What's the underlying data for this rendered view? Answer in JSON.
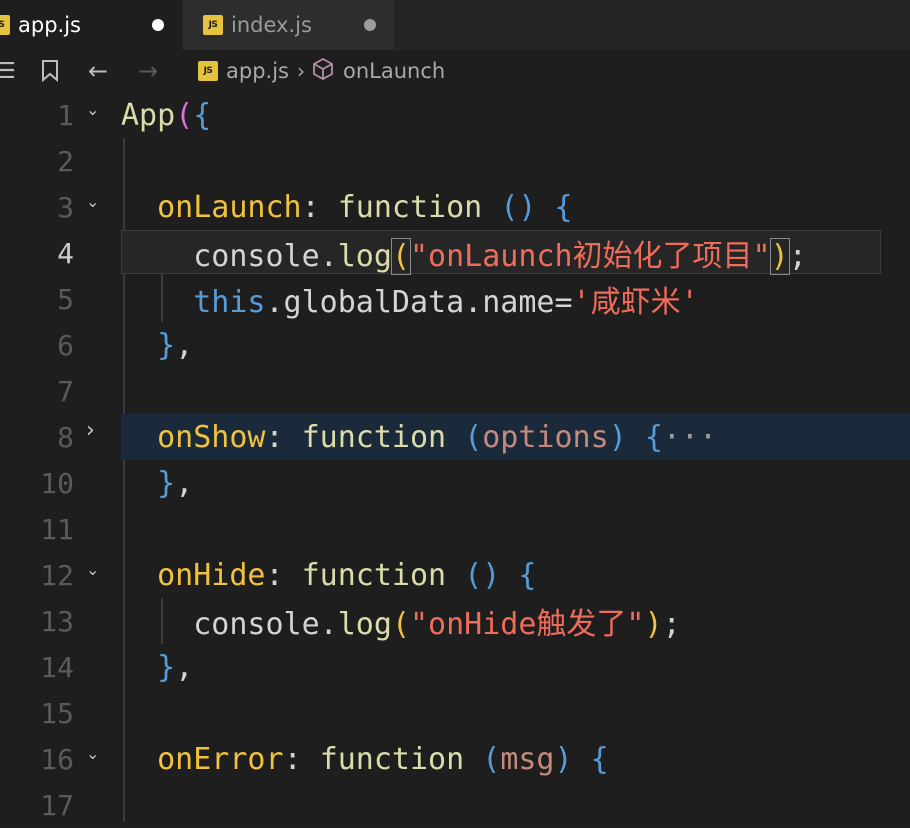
{
  "tabs": [
    {
      "label": "app.js",
      "icon": "js-file-icon",
      "active": true
    },
    {
      "label": "index.js",
      "icon": "js-file-icon",
      "active": false
    }
  ],
  "breadcrumb": {
    "file": "app.js",
    "symbol": "onLaunch"
  },
  "icons": {
    "js_badge": "JS",
    "menu": "☰",
    "back": "←",
    "forward": "→",
    "chevron_down": "⌄",
    "chevron_right": "›",
    "crumb_sep": "›",
    "cube": "⬡"
  },
  "colors": {
    "editor_bg": "#1e1e1e",
    "function_keyword": "#dcdcaa",
    "property": "#f0c23d",
    "string": "#ef6b5a"
  },
  "editor": {
    "current_line": 4,
    "lines": [
      {
        "n": "1",
        "fold": "down",
        "code": "App({"
      },
      {
        "n": "2",
        "fold": "",
        "code": ""
      },
      {
        "n": "3",
        "fold": "down",
        "code": "  onLaunch: function () {"
      },
      {
        "n": "4",
        "fold": "",
        "code": "    console.log(\"onLaunch初始化了项目\");"
      },
      {
        "n": "5",
        "fold": "",
        "code": "    this.globalData.name='咸虾米'"
      },
      {
        "n": "6",
        "fold": "",
        "code": "  },"
      },
      {
        "n": "7",
        "fold": "",
        "code": ""
      },
      {
        "n": "8",
        "fold": "right",
        "code": "  onShow: function (options) {···"
      },
      {
        "n": "10",
        "fold": "",
        "code": "  },"
      },
      {
        "n": "11",
        "fold": "",
        "code": ""
      },
      {
        "n": "12",
        "fold": "down",
        "code": "  onHide: function () {"
      },
      {
        "n": "13",
        "fold": "",
        "code": "    console.log(\"onHide触发了\");"
      },
      {
        "n": "14",
        "fold": "",
        "code": "  },"
      },
      {
        "n": "15",
        "fold": "",
        "code": ""
      },
      {
        "n": "16",
        "fold": "down",
        "code": "  onError: function (msg) {"
      },
      {
        "n": "17",
        "fold": "",
        "code": ""
      }
    ]
  }
}
